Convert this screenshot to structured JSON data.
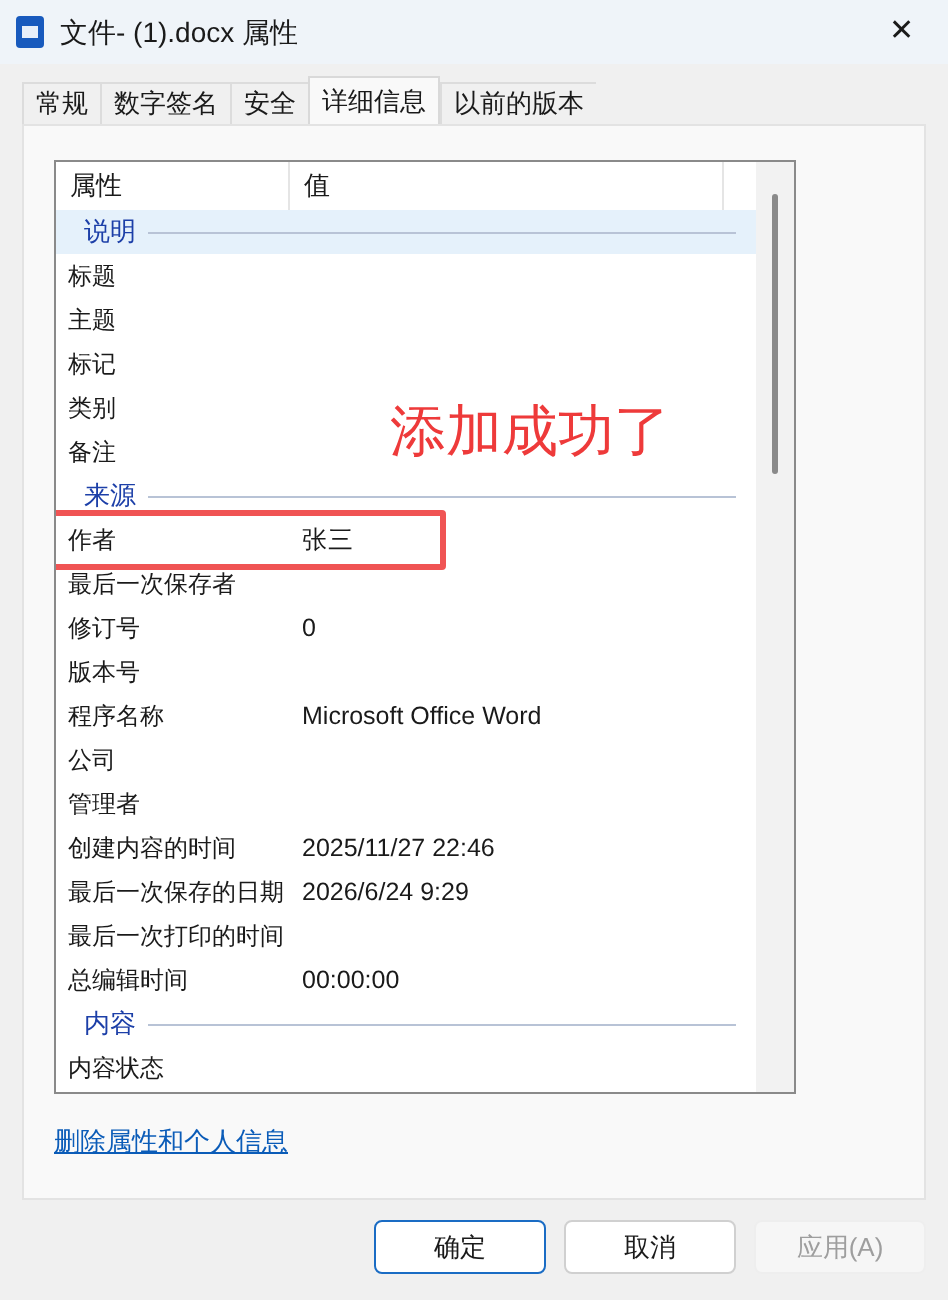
{
  "window": {
    "title": "文件- (1).docx 属性",
    "close": "✕"
  },
  "tabs": [
    {
      "label": "常规",
      "selected": false
    },
    {
      "label": "数字签名",
      "selected": false
    },
    {
      "label": "安全",
      "selected": false
    },
    {
      "label": "详细信息",
      "selected": true
    },
    {
      "label": "以前的版本",
      "selected": false
    }
  ],
  "table": {
    "columns": [
      "属性",
      "值"
    ],
    "rows": [
      {
        "kind": "section",
        "name": "说明",
        "selected": true
      },
      {
        "kind": "property",
        "name": "标题",
        "selected": false,
        "highlighted": false
      },
      {
        "kind": "property",
        "name": "主题",
        "selected": false,
        "highlighted": false
      },
      {
        "kind": "property",
        "name": "标记",
        "selected": false,
        "highlighted": false
      },
      {
        "kind": "property",
        "name": "类别",
        "selected": false,
        "highlighted": false
      },
      {
        "kind": "property",
        "name": "备注",
        "selected": false,
        "highlighted": false
      },
      {
        "kind": "section",
        "name": "来源",
        "selected": false
      },
      {
        "kind": "property",
        "name": "作者",
        "value": "张三",
        "selected": false,
        "highlighted": true
      },
      {
        "kind": "property",
        "name": "最后一次保存者",
        "selected": false,
        "highlighted": false
      },
      {
        "kind": "property",
        "name": "修订号",
        "value": "0",
        "selected": false,
        "highlighted": false
      },
      {
        "kind": "property",
        "name": "版本号",
        "selected": false,
        "highlighted": false
      },
      {
        "kind": "property",
        "name": "程序名称",
        "value": "Microsoft Office Word",
        "selected": false,
        "highlighted": false
      },
      {
        "kind": "property",
        "name": "公司",
        "selected": false,
        "highlighted": false
      },
      {
        "kind": "property",
        "name": "管理者",
        "selected": false,
        "highlighted": false
      },
      {
        "kind": "property",
        "name": "创建内容的时间",
        "value": "2025/11/27 22:46",
        "selected": false,
        "highlighted": false
      },
      {
        "kind": "property",
        "name": "最后一次保存的日期",
        "value": "2026/6/24 9:29",
        "selected": false,
        "highlighted": false
      },
      {
        "kind": "property",
        "name": "最后一次打印的时间",
        "selected": false,
        "highlighted": false
      },
      {
        "kind": "property",
        "name": "总编辑时间",
        "value": "00:00:00",
        "selected": false,
        "highlighted": false
      },
      {
        "kind": "section",
        "name": "内容",
        "selected": false
      },
      {
        "kind": "property",
        "name": "内容状态",
        "selected": false,
        "highlighted": false
      }
    ]
  },
  "annotation": "添加成功了",
  "link": "删除属性和个人信息",
  "buttons": [
    {
      "label": "确定",
      "default": true,
      "disabled": false
    },
    {
      "label": "取消",
      "default": false,
      "disabled": false
    },
    {
      "label": "应用(A)",
      "default": false,
      "disabled": true
    }
  ]
}
